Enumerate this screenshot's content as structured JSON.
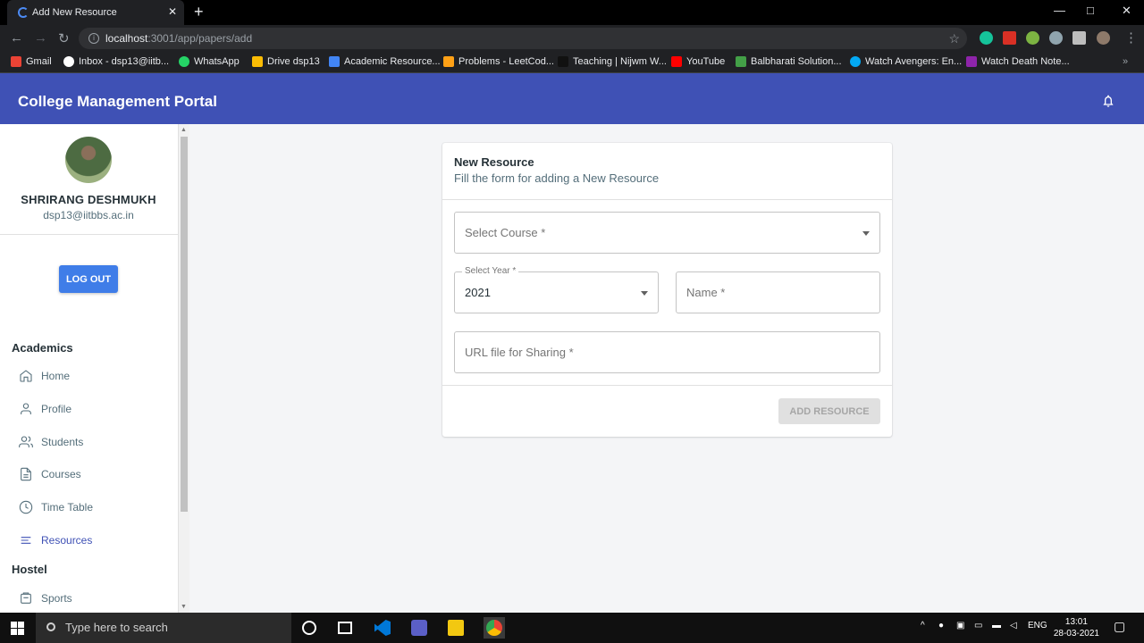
{
  "browser": {
    "tab_title": "Add New Resource",
    "url_host": "localhost",
    "url_path": ":3001/app/papers/add",
    "bookmarks": [
      "Gmail",
      "Inbox - dsp13@iitb...",
      "WhatsApp",
      "Drive dsp13",
      "Academic Resource...",
      "Problems - LeetCod...",
      "Teaching | Nijwm W...",
      "YouTube",
      "Balbharati Solution...",
      "Watch Avengers: En...",
      "Watch Death Note..."
    ],
    "colors": {
      "appbar": "#3f51b5",
      "active": "#3f51b5",
      "button": "#3f7de8"
    }
  },
  "app": {
    "title": "College Management Portal"
  },
  "user": {
    "name": "SHRIRANG DESHMUKH",
    "email": "dsp13@iitbbs.ac.in",
    "logout_label": "LOG OUT"
  },
  "sidebar": {
    "section_academics": "Academics",
    "section_hostel": "Hostel",
    "items": [
      {
        "label": "Home",
        "icon": "home-icon"
      },
      {
        "label": "Profile",
        "icon": "user-icon"
      },
      {
        "label": "Students",
        "icon": "users-icon"
      },
      {
        "label": "Courses",
        "icon": "file-icon"
      },
      {
        "label": "Time Table",
        "icon": "clock-icon"
      },
      {
        "label": "Resources",
        "icon": "list-icon",
        "active": true
      },
      {
        "label": "Sports",
        "icon": "sports-icon"
      }
    ]
  },
  "form": {
    "title": "New Resource",
    "subtitle": "Fill the form for adding a New Resource",
    "course_placeholder": "Select Course *",
    "year_label": "Select Year *",
    "year_value": "2021",
    "name_placeholder": "Name *",
    "url_placeholder": "URL file for Sharing *",
    "submit_label": "ADD RESOURCE"
  },
  "taskbar": {
    "search_placeholder": "Type here to search",
    "language": "ENG",
    "time": "13:01",
    "date": "28-03-2021"
  }
}
